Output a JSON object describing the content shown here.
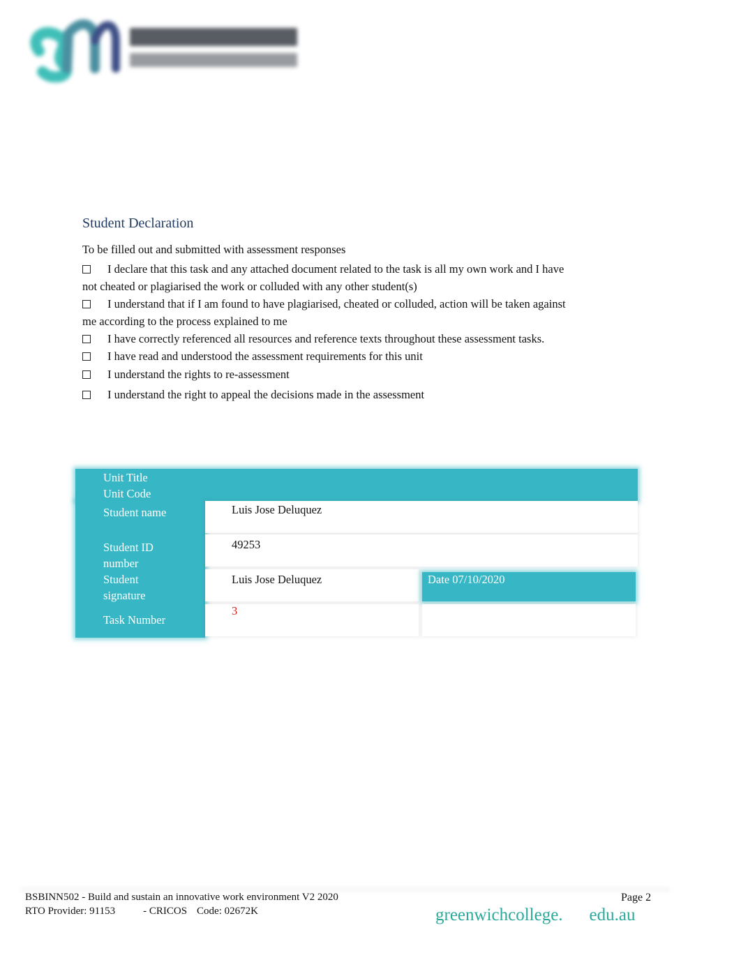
{
  "header": {
    "logo": {
      "name": "Greenwich Management College",
      "icon": "gmc-logo-icon",
      "colors": {
        "teal": "#3fbfb8",
        "navy": "#3e4f86"
      }
    }
  },
  "declaration": {
    "title": "Student Declaration",
    "intro": "To be filled out and submitted with assessment responses",
    "items": [
      {
        "checked": false,
        "text": "I declare that this task and any attached document related to the task is all my own work and I have not cheated or plagiarised the work or colluded with any other student(s)"
      },
      {
        "checked": false,
        "text": "I understand that if I am found to have plagiarised, cheated or colluded, action will be taken against me according to the process explained to me"
      },
      {
        "checked": false,
        "text": "I have correctly referenced all resources and reference texts throughout these assessment tasks."
      },
      {
        "checked": false,
        "text": "I have read and understood the assessment requirements for this unit"
      },
      {
        "checked": false,
        "text": "I understand the rights to re-assessment"
      },
      {
        "checked": false,
        "text": "I understand the right to appeal the decisions made in the assessment"
      }
    ]
  },
  "form": {
    "unit_title_label": "Unit Title",
    "unit_code_label": "Unit Code",
    "student_name_label": "Student name",
    "student_name_value": "Luis Jose Deluquez",
    "student_id_label": "Student ID number",
    "student_id_value": "49253",
    "student_signature_label": "Student signature",
    "student_signature_value": "Luis Jose Deluquez",
    "date_label": "Date 07/10/2020",
    "task_number_label": "Task Number",
    "task_number_value": "3",
    "colors": {
      "header": "#37b7c5",
      "task_value": "#e11b1b"
    }
  },
  "footer": {
    "unit": "BSBINN502 - Build and sustain an innovative work environment V2 2020",
    "rto": "RTO Provider: 91153",
    "cricos": "- CRICOS",
    "cricos_code": "Code: 02672K",
    "page": "Page 2",
    "website_part1": "greenwichcollege.",
    "website_part2": "edu.au",
    "link_color": "#2aa99c"
  }
}
